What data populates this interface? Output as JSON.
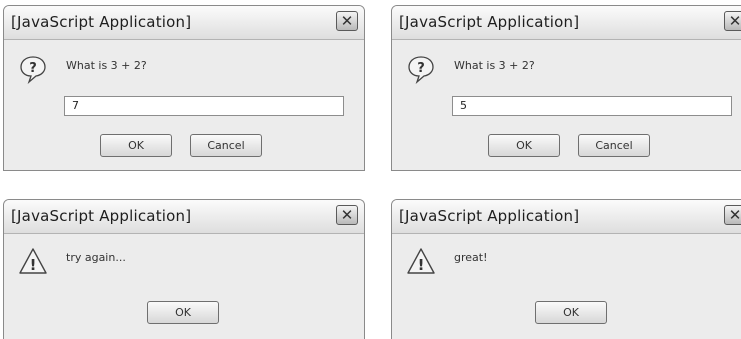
{
  "dialogs": [
    {
      "title": "[JavaScript Application]",
      "close_glyph": "✕",
      "icon": "question-icon",
      "message": "What is 3 + 2?",
      "input_value": "7",
      "ok_label": "OK",
      "cancel_label": "Cancel"
    },
    {
      "title": "[JavaScript Application]",
      "close_glyph": "✕",
      "icon": "question-icon",
      "message": "What is 3 + 2?",
      "input_value": "5",
      "ok_label": "OK",
      "cancel_label": "Cancel"
    },
    {
      "title": "[JavaScript Application]",
      "close_glyph": "✕",
      "icon": "warning-icon",
      "message": "try again...",
      "ok_label": "OK"
    },
    {
      "title": "[JavaScript Application]",
      "close_glyph": "✕",
      "icon": "warning-icon",
      "message": "great!",
      "ok_label": "OK"
    }
  ]
}
